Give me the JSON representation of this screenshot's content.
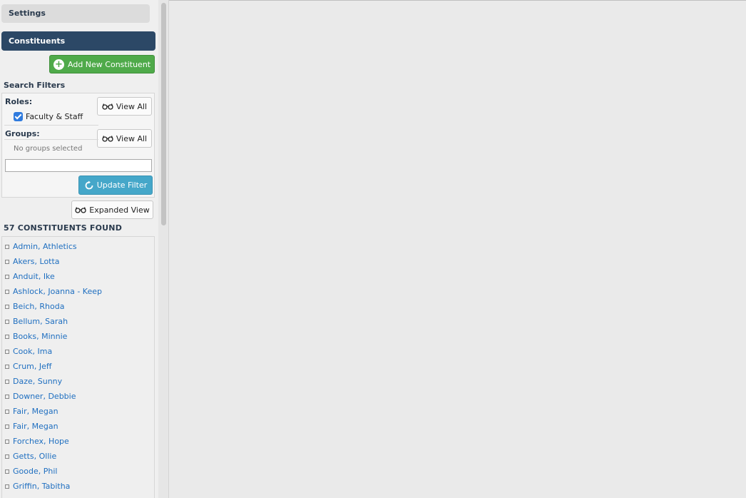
{
  "sidebar": {
    "settings_label": "Settings",
    "section_title": "Constituents",
    "add_button_label": "Add New Constituent",
    "filters_heading": "Search Filters",
    "roles_label": "Roles:",
    "roles_view_all": "View All",
    "role_option": "Faculty & Staff",
    "role_checked": true,
    "groups_label": "Groups:",
    "groups_view_all": "View All",
    "no_groups_text": "No groups selected",
    "filter_input_value": "",
    "update_button_label": "Update Filter",
    "expanded_view_label": "Expanded View",
    "found_heading": "57 CONSTITUENTS FOUND",
    "constituents": [
      "Admin, Athletics",
      "Akers, Lotta",
      "Anduit, Ike",
      "Ashlock, Joanna - Keep",
      "Beich, Rhoda",
      "Bellum, Sarah",
      "Books, Minnie",
      "Cook, Ima",
      "Crum, Jeff",
      "Daze, Sunny",
      "Downer, Debbie",
      "Fair, Megan",
      "Fair, Megan",
      "Forchex, Hope",
      "Getts, Ollie",
      "Goode, Phil",
      "Griffin, Tabitha"
    ]
  },
  "icons": {
    "add": "plus-circle-icon",
    "view": "glasses-icon",
    "update": "refresh-icon"
  },
  "colors": {
    "section_bar": "#2c4866",
    "add_button": "#4faa4a",
    "update_button": "#45a7c9",
    "link": "#1f6fc0"
  }
}
